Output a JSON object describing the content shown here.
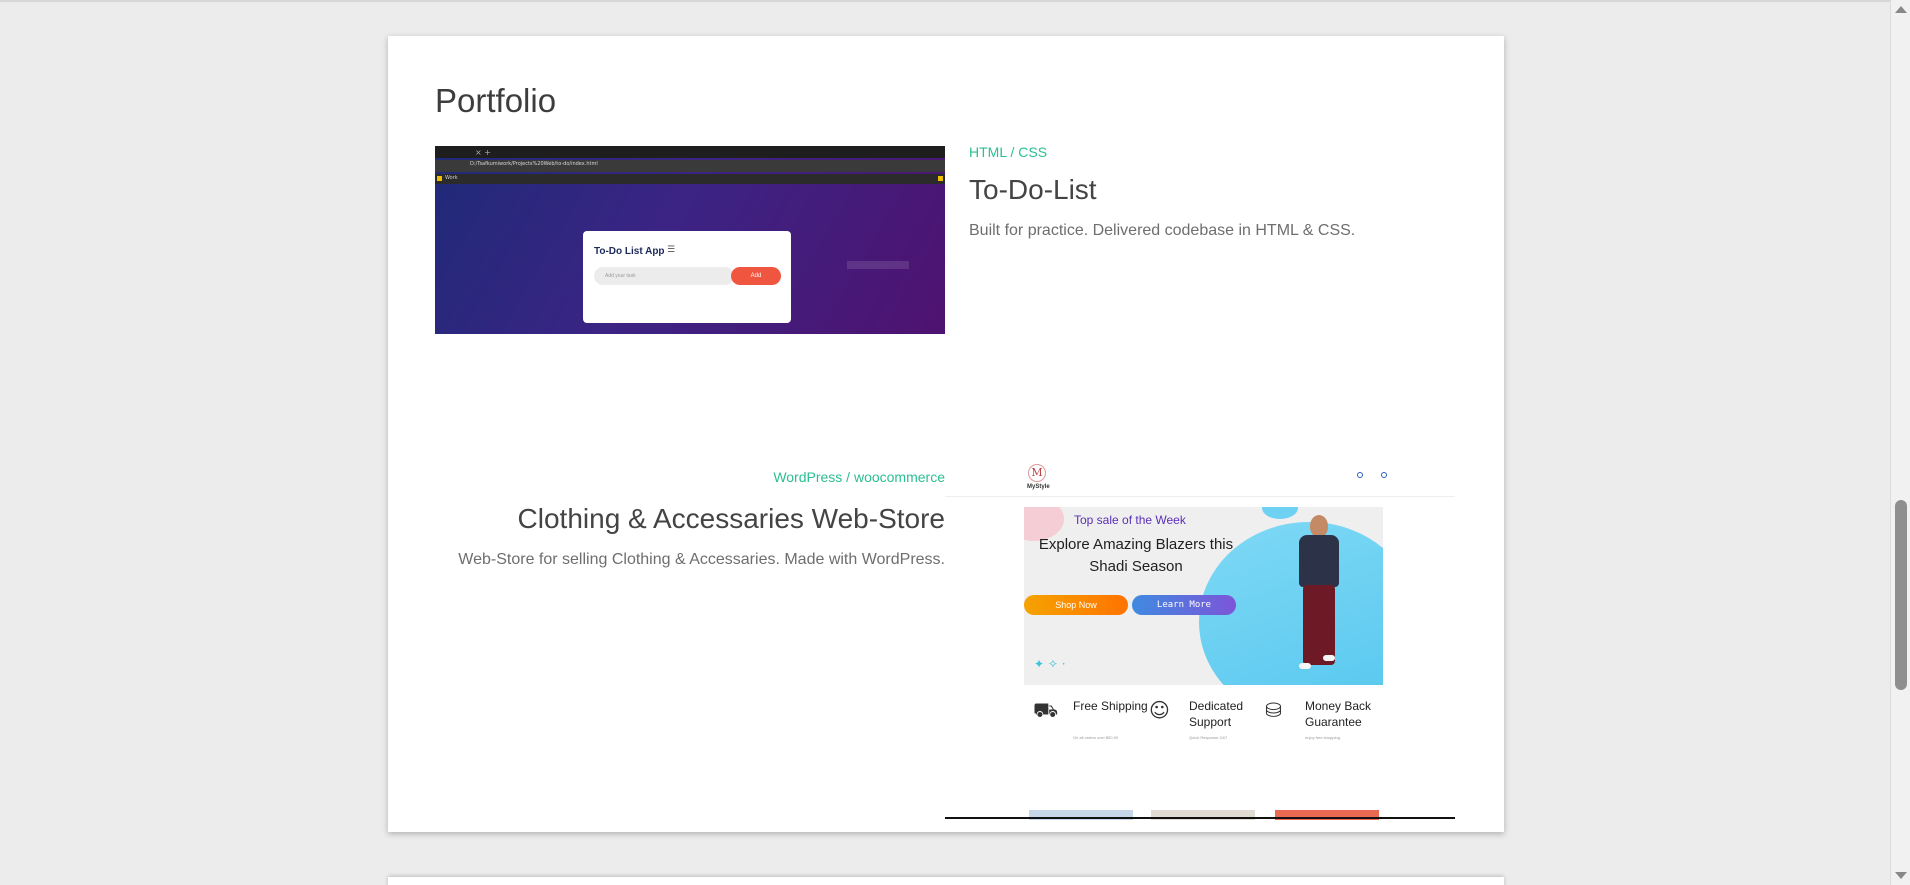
{
  "section": {
    "title": "Portfolio"
  },
  "items": [
    {
      "category": "HTML / CSS",
      "title": "To-Do-List",
      "description": "Built for practice. Delivered codebase in HTML & CSS.",
      "screenshot": {
        "address": "D:/Tsafkumiwork/Projects%20Web/to-do/index.html",
        "bookmark": "Work",
        "app_title": "To-Do List App",
        "input_placeholder": "Add your task",
        "add_label": "Add"
      }
    },
    {
      "category": "WordPress / woocommerce",
      "title": "Clothing & Accessaries Web-Store",
      "description": "Web-Store for selling Clothing & Accessaries. Made with WordPress.",
      "screenshot": {
        "logo_letter": "M",
        "logo_text": "MyStyle",
        "sale_text": "Top sale of the Week",
        "heading": "Explore Amazing Blazers this Shadi Season",
        "shop_label": "Shop Now",
        "learn_label": "Learn More",
        "features": [
          {
            "icon": "truck-icon",
            "label": "Free Shipping",
            "sub": "On all orders over $50.00"
          },
          {
            "icon": "support-icon",
            "label": "Dedicated Support",
            "sub": "Quick Response 24/7"
          },
          {
            "icon": "money-back-icon",
            "label": "Money Back Guarantee",
            "sub": "enjoy free shopping"
          }
        ]
      }
    }
  ],
  "colors": {
    "accent": "#2bbf93",
    "todo_add": "#f0553f",
    "shop_button": "#ff7300",
    "learn_button": "#7d55d8"
  }
}
